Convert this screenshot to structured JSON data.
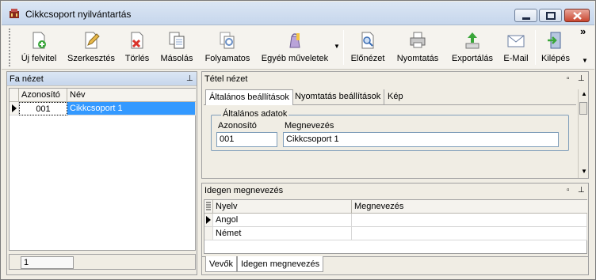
{
  "window": {
    "title": "Cikkcsoport nyilvántartás"
  },
  "toolbar": {
    "items": [
      {
        "label": "Új felvitel",
        "icon": "new-record-icon"
      },
      {
        "label": "Szerkesztés",
        "icon": "edit-icon"
      },
      {
        "label": "Törlés",
        "icon": "delete-icon"
      },
      {
        "label": "Másolás",
        "icon": "copy-icon"
      },
      {
        "label": "Folyamatos",
        "icon": "continuous-icon"
      },
      {
        "label": "Egyéb műveletek",
        "icon": "other-actions-icon"
      },
      {
        "label": "Előnézet",
        "icon": "preview-icon"
      },
      {
        "label": "Nyomtatás",
        "icon": "print-icon"
      },
      {
        "label": "Exportálás",
        "icon": "export-icon"
      },
      {
        "label": "E-Mail",
        "icon": "email-icon"
      },
      {
        "label": "Kilépés",
        "icon": "exit-icon"
      }
    ],
    "overflow": "»"
  },
  "tree": {
    "title": "Fa nézet",
    "columns": [
      "Azonosító",
      "Név"
    ],
    "rows": [
      {
        "id": "001",
        "name": "Cikkcsoport 1"
      }
    ],
    "status": "1"
  },
  "detail": {
    "title": "Tétel nézet",
    "tabs": [
      "Általános beállítások",
      "Nyomtatás beállítások",
      "Kép"
    ],
    "group_title": "Általános adatok",
    "id_label": "Azonosító",
    "id_value": "001",
    "name_label": "Megnevezés",
    "name_value": "Cikkcsoport 1"
  },
  "foreign": {
    "title": "Idegen megnevezés",
    "columns": [
      "Nyelv",
      "Megnevezés"
    ],
    "rows": [
      {
        "lang": "Angol",
        "name": ""
      },
      {
        "lang": "Német",
        "name": ""
      }
    ]
  },
  "bottom_tabs": [
    "Vevők",
    "Idegen megnevezés"
  ],
  "colors": {
    "selection": "#3399ff",
    "titlebar": "#c6d6ec"
  }
}
